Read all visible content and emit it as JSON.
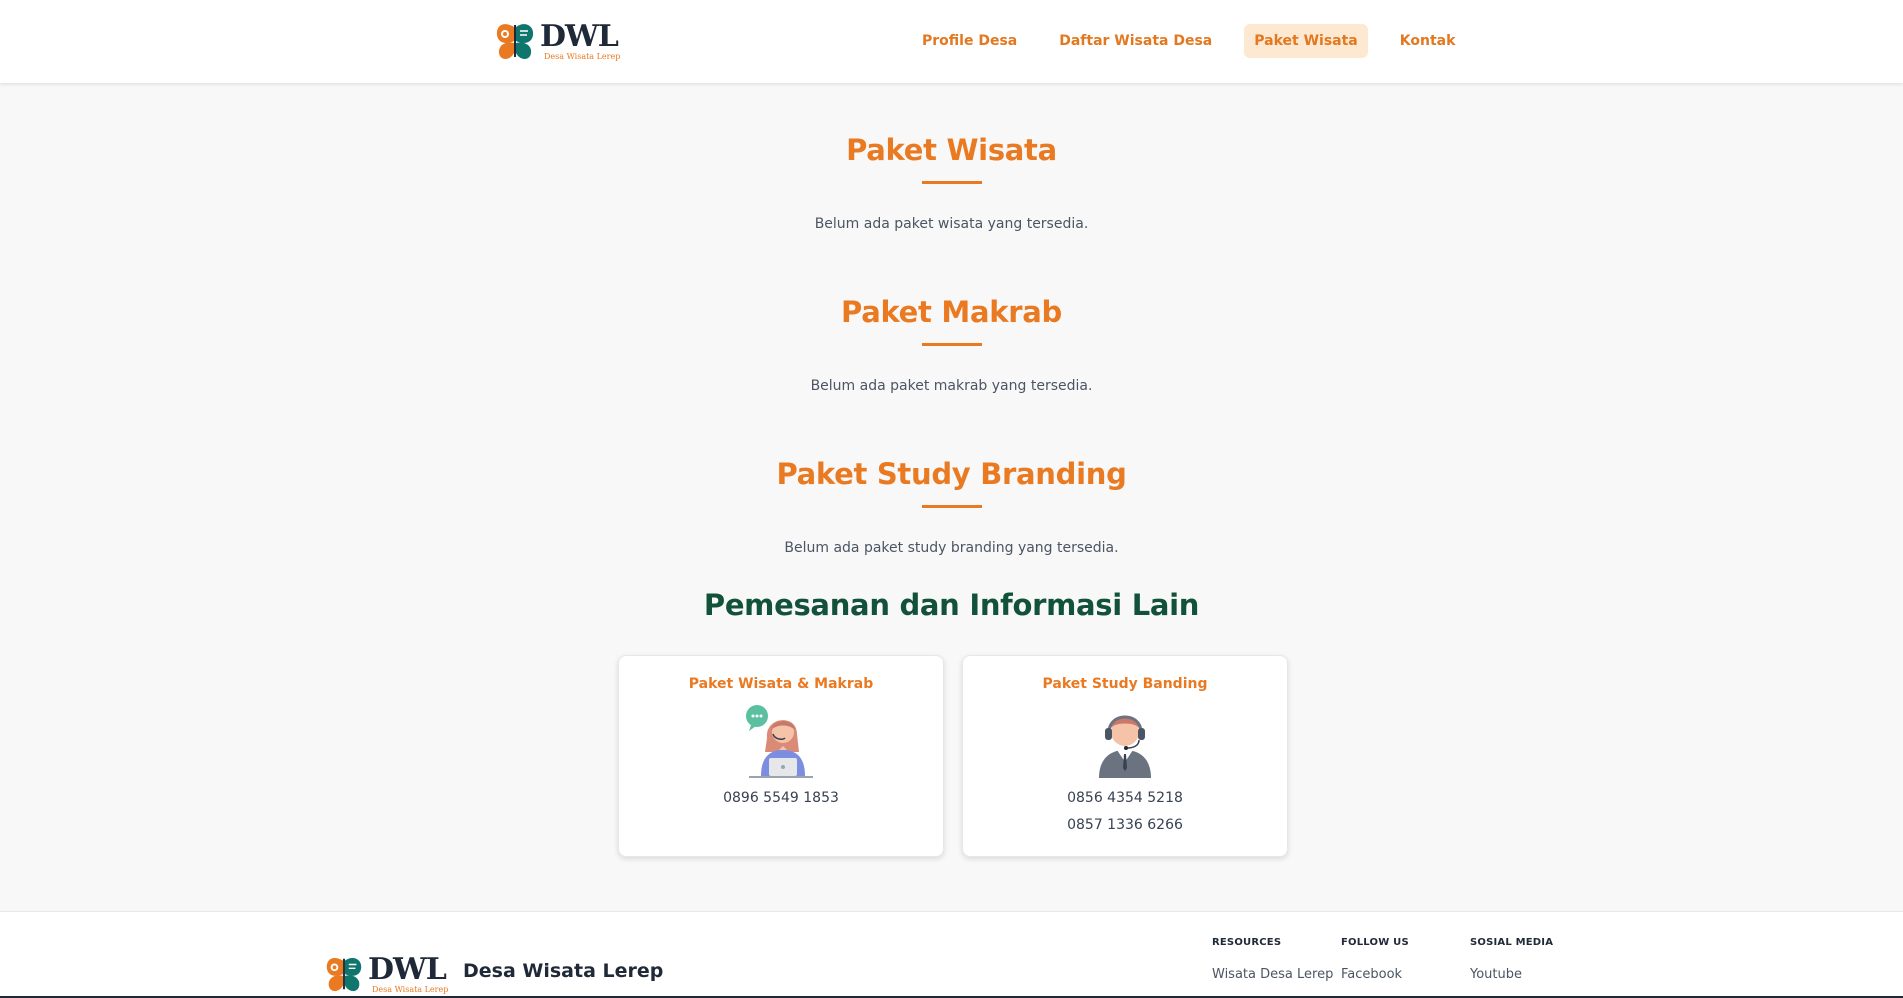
{
  "brand": {
    "logo_text": "DWL",
    "logo_subtitle": "Desa Wisata Lerep",
    "name": "Desa Wisata Lerep"
  },
  "nav": {
    "items": [
      {
        "label": "Profile Desa",
        "active": false
      },
      {
        "label": "Daftar Wisata Desa",
        "active": false
      },
      {
        "label": "Paket Wisata",
        "active": true
      },
      {
        "label": "Kontak",
        "active": false
      }
    ]
  },
  "sections": [
    {
      "title": "Paket Wisata",
      "message": "Belum ada paket wisata yang tersedia."
    },
    {
      "title": "Paket Makrab",
      "message": "Belum ada paket makrab yang tersedia."
    },
    {
      "title": "Paket Study Branding",
      "message": "Belum ada paket study branding yang tersedia."
    }
  ],
  "info": {
    "title": "Pemesanan dan Informasi Lain",
    "cards": [
      {
        "title": "Paket Wisata & Makrab",
        "illustration": "female-operator-icon",
        "phones": [
          "0896 5549 1853"
        ]
      },
      {
        "title": "Paket Study Banding",
        "illustration": "male-operator-icon",
        "phones": [
          "0856 4354 5218",
          "0857 1336 6266"
        ]
      }
    ]
  },
  "footer": {
    "columns": [
      {
        "heading": "RESOURCES",
        "link": "Wisata Desa Lerep"
      },
      {
        "heading": "FOLLOW US",
        "link": "Facebook"
      },
      {
        "heading": "SOSIAL MEDIA",
        "link": "Youtube"
      }
    ]
  },
  "colors": {
    "accent": "#ea7a22",
    "heading_green": "#13523a",
    "nav_active_bg": "#fde8d2",
    "page_bg": "#f8f8f8"
  }
}
